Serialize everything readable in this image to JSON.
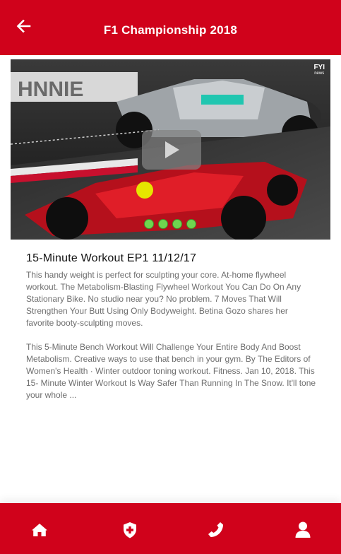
{
  "header": {
    "title": "F1 Championship 2018",
    "back_icon": "arrow-left-icon"
  },
  "media": {
    "logo_main": "FYI",
    "logo_sub": "news",
    "play_icon": "play-icon",
    "carousel_total": 4,
    "carousel_active": 1,
    "signage_text": "HNNIE"
  },
  "article": {
    "title": "15-Minute Workout EP1  11/12/17",
    "paragraph1": "This handy weight is perfect for sculpting your core. At-home flywheel workout. The Metabolism-Blasting Flywheel Workout You Can Do On Any Stationary Bike. No studio near you? No problem. 7 Moves That Will Strengthen Your Butt Using Only Bodyweight. Betina Gozo shares her favorite booty-sculpting moves.",
    "paragraph2": "This 5-Minute Bench Workout Will Challenge Your Entire Body And Boost Metabolism. Creative ways to use that bench in your gym. By The Editors of Women's Health · Winter outdoor toning workout. Fitness. Jan 10, 2018. This 15- Minute Winter Workout Is Way Safer Than Running In The Snow. It'll tone your whole ..."
  },
  "tabbar": {
    "items": [
      {
        "icon": "home-icon"
      },
      {
        "icon": "medical-shield-icon"
      },
      {
        "icon": "phone-icon"
      },
      {
        "icon": "user-icon"
      }
    ]
  },
  "colors": {
    "brand_red": "#d0021b",
    "dot_green": "#6fd64f",
    "body_text": "#6e6e6e"
  }
}
